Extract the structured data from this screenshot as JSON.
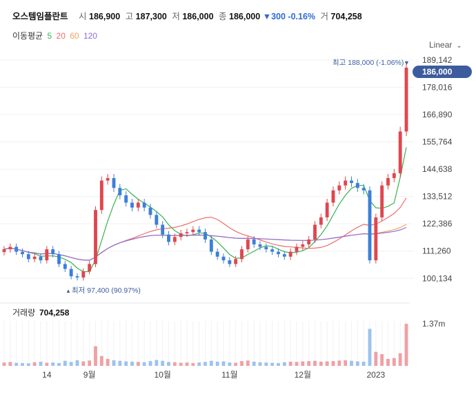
{
  "header": {
    "stock_name": "오스템임플란트",
    "open_label": "시",
    "open_value": "186,900",
    "high_label": "고",
    "high_value": "187,300",
    "low_label": "저",
    "low_value": "186,000",
    "close_label": "종",
    "close_value": "186,000",
    "change_arrow": "▼",
    "change_value": "300",
    "change_pct": "-0.16%",
    "volume_label": "거",
    "volume_value": "704,258"
  },
  "ma_legend": {
    "title": "이동평균",
    "periods": [
      "5",
      "20",
      "60",
      "120"
    ],
    "colors": [
      "#37b24d",
      "#ef6b6b",
      "#f5a25d",
      "#8e6bd8"
    ]
  },
  "scale_button": {
    "label": "Linear"
  },
  "annotations": {
    "high": "최고 188,000 (-1.06%)",
    "low": "최저 97,400 (90.97%)"
  },
  "current_price_tag": "186,000",
  "volume_panel": {
    "label": "거래량",
    "value": "704,258",
    "axis_tick": "1.37m"
  },
  "colors": {
    "up": "#e0464e",
    "down": "#3c7fd9",
    "current_tag": "#3d5c9e"
  },
  "chart_data": {
    "type": "candlestick",
    "ylim": [
      96000,
      190500
    ],
    "y_ticks": [
      "189,142",
      "178,016",
      "166,890",
      "155,764",
      "144,638",
      "133,512",
      "122,386",
      "111,260",
      "100,134"
    ],
    "y_tick_values": [
      189142,
      178016,
      166890,
      155764,
      144638,
      133512,
      122386,
      111260,
      100134
    ],
    "x_ticks": [
      {
        "label": "14",
        "index": 7
      },
      {
        "label": "9월",
        "index": 14
      },
      {
        "label": "10월",
        "index": 26
      },
      {
        "label": "11월",
        "index": 37
      },
      {
        "label": "12월",
        "index": 49
      },
      {
        "label": "2023",
        "index": 61
      }
    ],
    "close": [
      112000,
      113000,
      111000,
      110000,
      108000,
      109000,
      107500,
      112000,
      110000,
      106000,
      104000,
      101000,
      100500,
      103000,
      106000,
      128000,
      140000,
      141000,
      137000,
      134000,
      131000,
      129000,
      131000,
      129000,
      126000,
      122000,
      118000,
      115000,
      117000,
      118500,
      119000,
      120000,
      119000,
      116000,
      111000,
      109000,
      107500,
      106000,
      108000,
      112000,
      116000,
      114000,
      113000,
      112000,
      111000,
      110000,
      109000,
      111000,
      113000,
      114000,
      116000,
      122000,
      125000,
      131000,
      136000,
      138000,
      140000,
      139000,
      137000,
      136000,
      107500,
      125000,
      138000,
      141000,
      143000,
      160000,
      186000
    ],
    "volume": [
      120000,
      140000,
      110000,
      100000,
      90000,
      130000,
      150000,
      110000,
      120000,
      100000,
      180000,
      140000,
      200000,
      160000,
      190000,
      700000,
      350000,
      250000,
      200000,
      180000,
      160000,
      150000,
      140000,
      130000,
      170000,
      210000,
      180000,
      140000,
      130000,
      110000,
      120000,
      100000,
      120000,
      140000,
      180000,
      150000,
      160000,
      120000,
      110000,
      170000,
      190000,
      150000,
      130000,
      120000,
      110000,
      100000,
      130000,
      150000,
      140000,
      160000,
      170000,
      180000,
      150000,
      160000,
      170000,
      190000,
      200000,
      180000,
      160000,
      150000,
      1320000,
      500000,
      420000,
      250000,
      280000,
      450000,
      1500000
    ]
  }
}
